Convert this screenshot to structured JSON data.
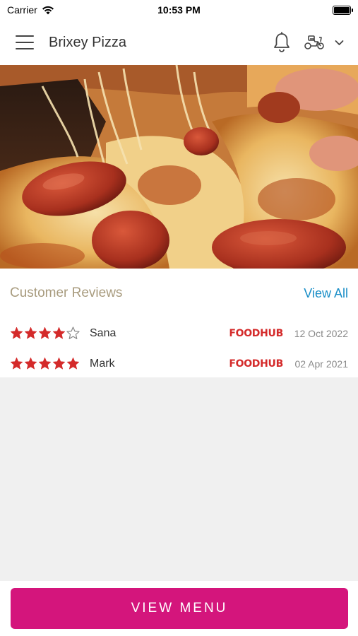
{
  "status_bar": {
    "carrier": "Carrier",
    "time": "10:53 PM"
  },
  "header": {
    "title": "Brixey Pizza",
    "icons": [
      "hamburger-menu-icon",
      "bell-icon",
      "scooter-icon",
      "chevron-down-icon"
    ]
  },
  "hero": {
    "image": "pizza-photo"
  },
  "reviews": {
    "title": "Customer Reviews",
    "view_all_label": "View All",
    "items": [
      {
        "rating": 4,
        "name": "Sana",
        "source": "FOODHUB",
        "date": "12 Oct 2022"
      },
      {
        "rating": 5,
        "name": "Mark",
        "source": "FOODHUB",
        "date": "02 Apr 2021"
      }
    ]
  },
  "bottom": {
    "view_menu_label": "VIEW MENU"
  },
  "colors": {
    "accent": "#d4157c",
    "link": "#1a8ec7",
    "star": "#d42a2a",
    "section_title": "#a89b7e"
  }
}
